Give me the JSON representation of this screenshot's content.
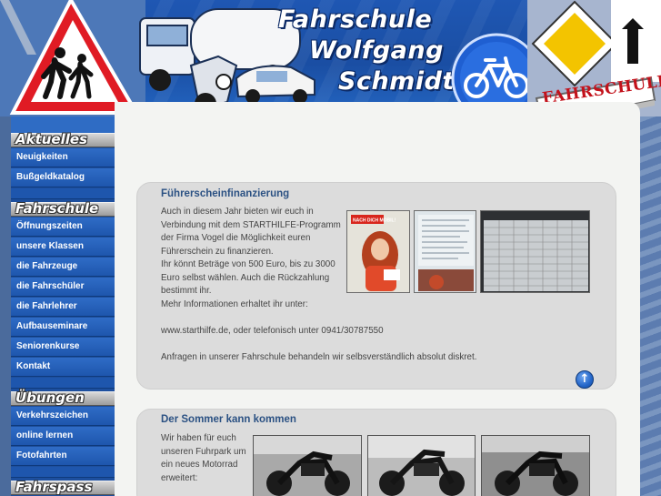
{
  "header": {
    "title_line1": "Fahrschule",
    "title_line2": "Wolfgang",
    "title_line3": "Schmidt",
    "sign_label": "FAHRSCHULE"
  },
  "sidebar": {
    "sections": [
      {
        "title": "Aktuelles",
        "items": [
          "Neuigkeiten",
          "Bußgeldkatalog"
        ]
      },
      {
        "title": "Fahrschule",
        "items": [
          "Öffnungszeiten",
          "unsere Klassen",
          "die Fahrzeuge",
          "die Fahrschüler",
          "die Fahrlehrer",
          "Aufbauseminare",
          "Seniorenkurse",
          "Kontakt"
        ]
      },
      {
        "title": "Übungen",
        "items": [
          "Verkehrszeichen",
          "online lernen",
          "Fotofahrten"
        ]
      },
      {
        "title": "Fahrspass",
        "items": []
      }
    ]
  },
  "article1": {
    "title": "Führerscheinfinanzierung",
    "lines": [
      "Auch in diesem Jahr bieten wir euch in",
      "Verbindung mit dem STARTHILFE-Programm",
      "der Firma Vogel die Möglichkeit euren",
      "Führerschein zu finanzieren.",
      "Ihr könnt Beträge von 500 Euro, bis zu 3000",
      "Euro selbst wählen. Auch die Rückzahlung",
      "bestimmt ihr.",
      "Mehr Informationen erhaltet ihr unter:",
      "",
      "www.starthilfe.de, oder telefonisch unter 0941/30787550",
      "",
      "Anfragen in unserer Fahrschule behandeln wir selbsverständlich absolut diskret."
    ],
    "thumb1_caption": "NACH DICH MOBIL!",
    "up_icon": "arrow-up-icon"
  },
  "article2": {
    "title": "Der Sommer kann kommen",
    "lines": [
      "Wir haben für euch",
      "unseren Fuhrpark um",
      "ein neues Motorrad",
      "erweitert:"
    ]
  },
  "colors": {
    "header_blue": "#1f57b3",
    "sidebar_blue": "#1e56ad",
    "title_blue": "#2b5183",
    "sign_red": "#c3121b"
  }
}
